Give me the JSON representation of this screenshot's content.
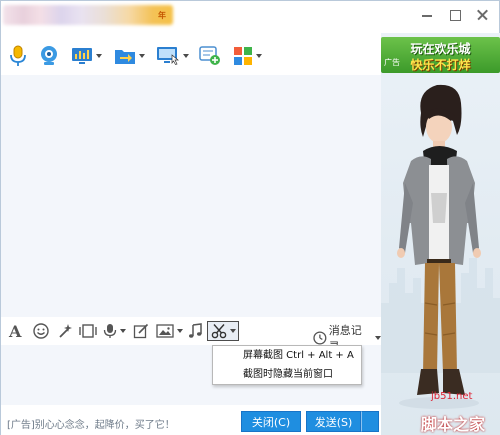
{
  "window": {
    "title_tag": "年"
  },
  "banner": {
    "line1": "玩在欢乐城",
    "line2": "快乐不打烊",
    "ad_label": "广告"
  },
  "format_toolbar": {
    "history_label": "消息记录"
  },
  "screenshot_menu": {
    "items": [
      {
        "label": "屏幕截图 Ctrl + Alt + A"
      },
      {
        "label": "截图时隐藏当前窗口"
      }
    ]
  },
  "bottom": {
    "ad_text": "[广告]别心心念念，起降价，买了它！",
    "close_label": "关闭(C)",
    "send_label": "发送(S)"
  },
  "watermark": {
    "site": "jb51.net",
    "name": "脚本之家"
  },
  "colors": {
    "accent": "#1f8ee0",
    "chat_bg": "#f3f6fb",
    "banner_green": "#4caf37"
  }
}
